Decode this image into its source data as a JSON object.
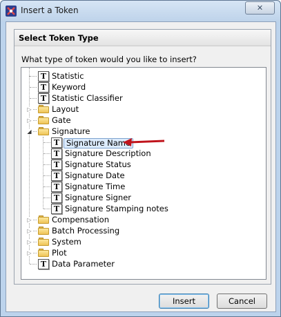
{
  "window": {
    "title": "Insert a Token",
    "close_symbol": "✕"
  },
  "group": {
    "header": "Select Token Type",
    "question": "What type of token would you like to insert?"
  },
  "tree": [
    {
      "label": "Statistic",
      "icon": "token-icon",
      "expandable": false
    },
    {
      "label": "Keyword",
      "icon": "token-icon",
      "expandable": false
    },
    {
      "label": "Statistic Classifier",
      "icon": "token-icon",
      "expandable": false
    },
    {
      "label": "Layout",
      "icon": "folder-icon",
      "expandable": true,
      "expanded": false
    },
    {
      "label": "Gate",
      "icon": "folder-icon",
      "expandable": true,
      "expanded": false
    },
    {
      "label": "Signature",
      "icon": "folder-icon",
      "expandable": true,
      "expanded": true,
      "children": [
        {
          "label": "Signature Name",
          "icon": "token-icon",
          "selected": true
        },
        {
          "label": "Signature Description",
          "icon": "token-icon"
        },
        {
          "label": "Signature Status",
          "icon": "token-icon"
        },
        {
          "label": "Signature Date",
          "icon": "token-icon"
        },
        {
          "label": "Signature Time",
          "icon": "token-icon"
        },
        {
          "label": "Signature Signer",
          "icon": "token-icon"
        },
        {
          "label": "Signature Stamping notes",
          "icon": "token-icon"
        }
      ]
    },
    {
      "label": "Compensation",
      "icon": "folder-icon",
      "expandable": true,
      "expanded": false
    },
    {
      "label": "Batch Processing",
      "icon": "folder-icon",
      "expandable": true,
      "expanded": false
    },
    {
      "label": "System",
      "icon": "folder-icon",
      "expandable": true,
      "expanded": false
    },
    {
      "label": "Plot",
      "icon": "folder-icon",
      "expandable": true,
      "expanded": false
    },
    {
      "label": "Data Parameter",
      "icon": "token-icon",
      "expandable": false
    }
  ],
  "token_glyph": "T",
  "annotation": {
    "color": "#c0141c"
  },
  "buttons": {
    "insert": "Insert",
    "cancel": "Cancel"
  }
}
